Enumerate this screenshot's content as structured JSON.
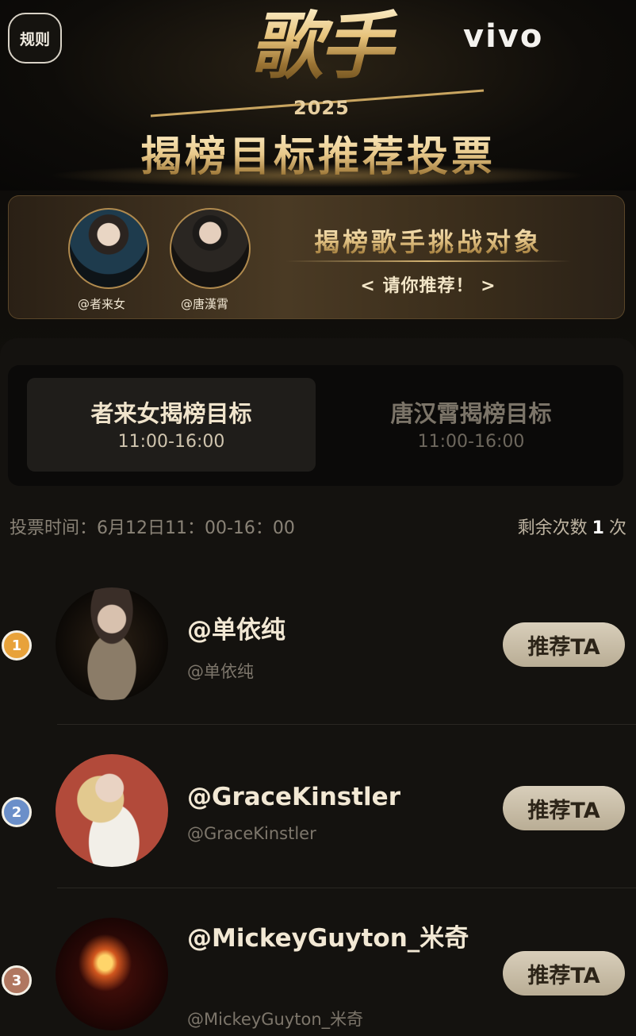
{
  "header": {
    "rules_label": "规则",
    "brand": "vivo",
    "logo_text": "歌手",
    "logo_year": "2025",
    "banner_title": "揭榜目标推荐投票"
  },
  "challenge": {
    "challengers": [
      {
        "name": "@者来女"
      },
      {
        "name": "@唐漢霄"
      }
    ],
    "title": "揭榜歌手挑战对象",
    "cta": "< 请你推荐！ >"
  },
  "tabs": [
    {
      "name": "者来女揭榜目标",
      "time": "11:00-16:00",
      "active": true
    },
    {
      "name": "唐汉霄揭榜目标",
      "time": "11:00-16:00",
      "active": false
    }
  ],
  "vote_info": {
    "time_text": "投票时间：6月12日11：00-16：00",
    "remaining_label": "剩余次数",
    "remaining_count": "1",
    "remaining_unit": "次"
  },
  "candidates": [
    {
      "rank": "1",
      "name": "@单依纯",
      "handle": "@单依纯",
      "button": "推荐TA"
    },
    {
      "rank": "2",
      "name": "@GraceKinstler",
      "handle": "@GraceKinstler",
      "button": "推荐TA"
    },
    {
      "rank": "3",
      "name": "@MickeyGuyton_米奇",
      "handle": "@MickeyGuyton_米奇",
      "button": "推荐TA"
    }
  ],
  "colors": {
    "accent_gold": "#d6b473",
    "button_bg": "#c9bea8",
    "rank1": "#e8a23a",
    "rank2": "#6b8fc9",
    "rank3": "#b07760"
  }
}
